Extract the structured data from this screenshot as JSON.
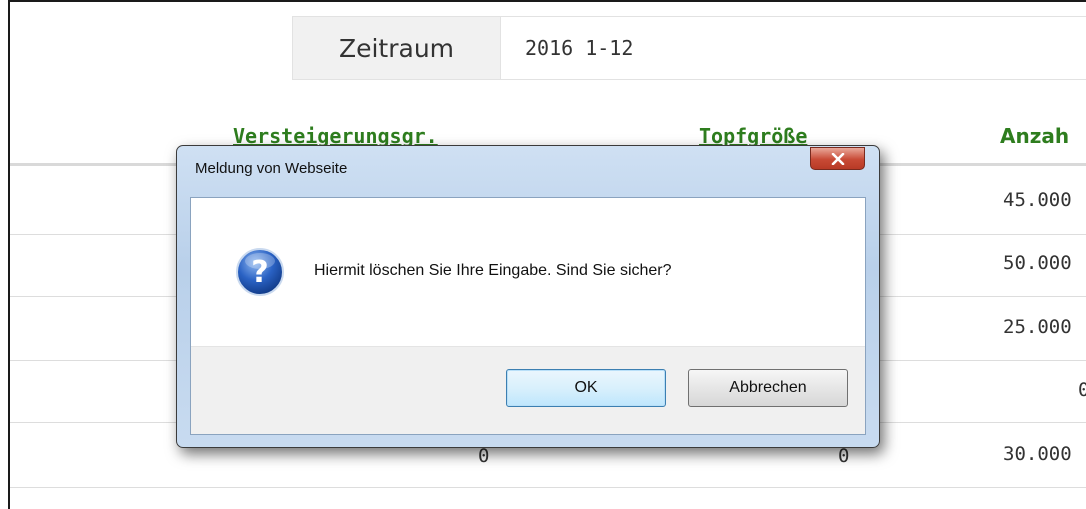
{
  "filter": {
    "label": "Zeitraum",
    "value": "2016 1-12"
  },
  "table": {
    "headers": [
      "Versteigerungsgr.",
      "Topfgröße",
      "Anzah"
    ],
    "rows": [
      {
        "col1": "",
        "col2": "",
        "col3": "45.000"
      },
      {
        "col1": "",
        "col2": "",
        "col3": "50.000"
      },
      {
        "col1": "",
        "col2": "",
        "col3": "25.000"
      },
      {
        "col1": "",
        "col2": "",
        "col3": "0"
      },
      {
        "col1": "0",
        "col2": "0",
        "col3": "30.000"
      }
    ]
  },
  "dialog": {
    "title": "Meldung von Webseite",
    "message": "Hiermit löschen Sie Ihre Eingabe. Sind Sie sicher?",
    "ok_label": "OK",
    "cancel_label": "Abbrechen",
    "icon": "question-icon"
  }
}
